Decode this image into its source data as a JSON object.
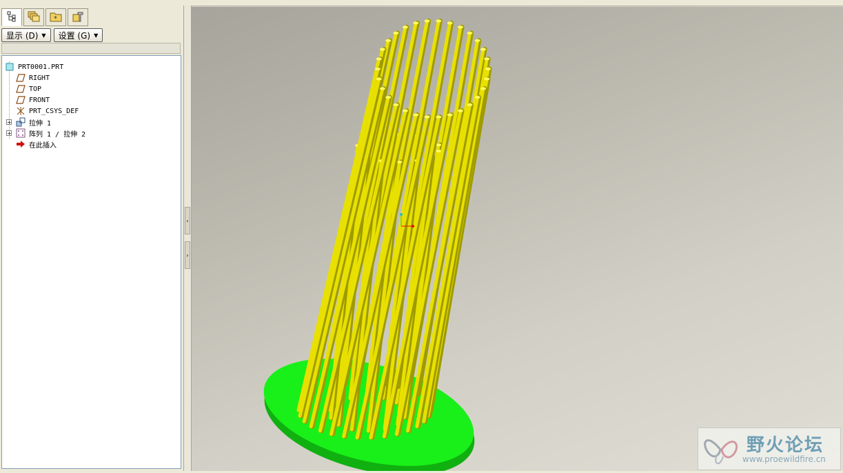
{
  "toolbar": {
    "display_label": "显示 (D)",
    "settings_label": "设置 (G)"
  },
  "tabs": [
    {
      "icon": "model-tree-icon",
      "active": true
    },
    {
      "icon": "layers-icon",
      "active": false
    },
    {
      "icon": "folder-browser-icon",
      "active": false
    },
    {
      "icon": "favorites-icon",
      "active": false
    }
  ],
  "tree": {
    "root": "PRT0001.PRT",
    "items": [
      {
        "label": "RIGHT",
        "icon": "datum-plane-icon"
      },
      {
        "label": "TOP",
        "icon": "datum-plane-icon"
      },
      {
        "label": "FRONT",
        "icon": "datum-plane-icon"
      },
      {
        "label": "PRT_CSYS_DEF",
        "icon": "coordinate-system-icon"
      },
      {
        "label": "拉伸 1",
        "icon": "extrude-icon"
      },
      {
        "label": "阵列 1 / 拉伸 2",
        "icon": "pattern-icon"
      },
      {
        "label": "在此插入",
        "icon": "insert-here-arrow-icon"
      }
    ]
  },
  "colors": {
    "rod": "#e8e000",
    "rod_shadow": "#9e9a00",
    "base": "#19f019",
    "base_side": "#10b010"
  },
  "watermark": {
    "title": "野火论坛",
    "url": "www.proewildfire.cn"
  }
}
